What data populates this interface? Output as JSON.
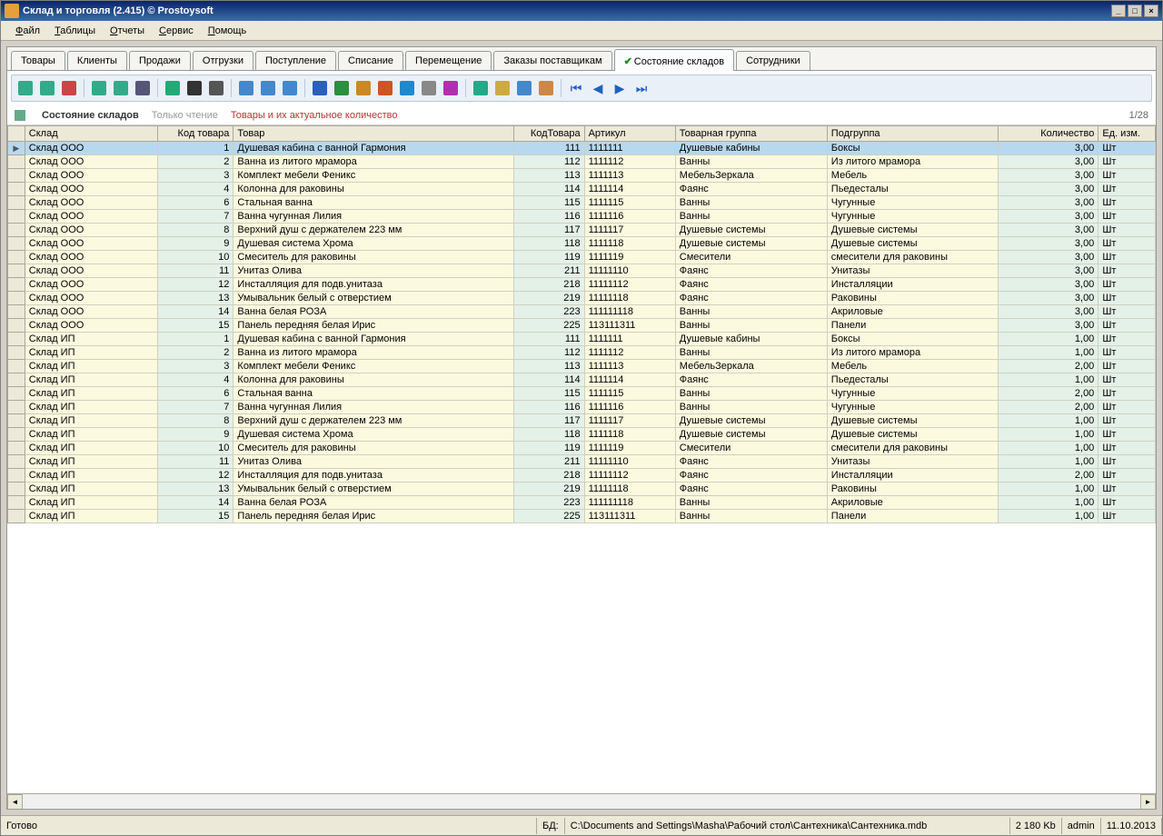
{
  "title": "Склад и торговля (2.415) © Prostoysoft",
  "menu": [
    "Файл",
    "Таблицы",
    "Отчеты",
    "Сервис",
    "Помощь"
  ],
  "tabs": [
    "Товары",
    "Клиенты",
    "Продажи",
    "Отгрузки",
    "Поступление",
    "Списание",
    "Перемещение",
    "Заказы поставщикам",
    "Состояние складов",
    "Сотрудники"
  ],
  "active_tab": 8,
  "subheader": {
    "title": "Состояние складов",
    "readonly": "Только чтение",
    "desc": "Товары и их актуальное количество",
    "page": "1/28"
  },
  "columns": [
    "Склад",
    "Код товара",
    "Товар",
    "КодТовара",
    "Артикул",
    "Товарная группа",
    "Подгруппа",
    "Количество",
    "Ед. изм."
  ],
  "rows": [
    [
      "Склад ООО",
      "1",
      "Душевая кабина с ванной Гармония",
      "111",
      "1111111",
      "Душевые кабины",
      "Боксы",
      "3,00",
      "Шт"
    ],
    [
      "Склад ООО",
      "2",
      "Ванна из литого мрамора",
      "112",
      "1111112",
      "Ванны",
      "Из литого мрамора",
      "3,00",
      "Шт"
    ],
    [
      "Склад ООО",
      "3",
      "Комплект мебели Феникс",
      "113",
      "1111113",
      "МебельЗеркала",
      "Мебель",
      "3,00",
      "Шт"
    ],
    [
      "Склад ООО",
      "4",
      "Колонна  для раковины",
      "114",
      "1111114",
      "Фаянс",
      "Пьедесталы",
      "3,00",
      "Шт"
    ],
    [
      "Склад ООО",
      "6",
      "Стальная ванна",
      "115",
      "1111115",
      "Ванны",
      "Чугунные",
      "3,00",
      "Шт"
    ],
    [
      "Склад ООО",
      "7",
      "Ванна чугунная Лилия",
      "116",
      "1111116",
      "Ванны",
      "Чугунные",
      "3,00",
      "Шт"
    ],
    [
      "Склад ООО",
      "8",
      "Верхний душ с держателем 223 мм",
      "117",
      "1111117",
      "Душевые системы",
      "Душевые системы",
      "3,00",
      "Шт"
    ],
    [
      "Склад ООО",
      "9",
      "Душевая система Хрома",
      "118",
      "1111118",
      "Душевые системы",
      "Душевые системы",
      "3,00",
      "Шт"
    ],
    [
      "Склад ООО",
      "10",
      "Смеситель для раковины",
      "119",
      "1111119",
      "Смесители",
      "смесители для раковины",
      "3,00",
      "Шт"
    ],
    [
      "Склад ООО",
      "11",
      "Унитаз Олива",
      "211",
      "11111110",
      "Фаянс",
      "Унитазы",
      "3,00",
      "Шт"
    ],
    [
      "Склад ООО",
      "12",
      "Инсталляция для подв.унитаза",
      "218",
      "11111112",
      "Фаянс",
      "Инсталляции",
      "3,00",
      "Шт"
    ],
    [
      "Склад ООО",
      "13",
      "Умывальник белый с отверстием",
      "219",
      "11111118",
      "Фаянс",
      "Раковины",
      "3,00",
      "Шт"
    ],
    [
      "Склад ООО",
      "14",
      "Ванна белая РОЗА",
      "223",
      "111111118",
      "Ванны",
      "Акриловые",
      "3,00",
      "Шт"
    ],
    [
      "Склад ООО",
      "15",
      "Панель передняя белая Ирис",
      "225",
      "113111311",
      "Ванны",
      "Панели",
      "3,00",
      "Шт"
    ],
    [
      "Склад ИП",
      "1",
      "Душевая кабина с ванной Гармония",
      "111",
      "1111111",
      "Душевые кабины",
      "Боксы",
      "1,00",
      "Шт"
    ],
    [
      "Склад ИП",
      "2",
      "Ванна из литого мрамора",
      "112",
      "1111112",
      "Ванны",
      "Из литого мрамора",
      "1,00",
      "Шт"
    ],
    [
      "Склад ИП",
      "3",
      "Комплект мебели Феникс",
      "113",
      "1111113",
      "МебельЗеркала",
      "Мебель",
      "2,00",
      "Шт"
    ],
    [
      "Склад ИП",
      "4",
      "Колонна  для раковины",
      "114",
      "1111114",
      "Фаянс",
      "Пьедесталы",
      "1,00",
      "Шт"
    ],
    [
      "Склад ИП",
      "6",
      "Стальная ванна",
      "115",
      "1111115",
      "Ванны",
      "Чугунные",
      "2,00",
      "Шт"
    ],
    [
      "Склад ИП",
      "7",
      "Ванна чугунная Лилия",
      "116",
      "1111116",
      "Ванны",
      "Чугунные",
      "2,00",
      "Шт"
    ],
    [
      "Склад ИП",
      "8",
      "Верхний душ с держателем 223 мм",
      "117",
      "1111117",
      "Душевые системы",
      "Душевые системы",
      "1,00",
      "Шт"
    ],
    [
      "Склад ИП",
      "9",
      "Душевая система Хрома",
      "118",
      "1111118",
      "Душевые системы",
      "Душевые системы",
      "1,00",
      "Шт"
    ],
    [
      "Склад ИП",
      "10",
      "Смеситель для раковины",
      "119",
      "1111119",
      "Смесители",
      "смесители для раковины",
      "1,00",
      "Шт"
    ],
    [
      "Склад ИП",
      "11",
      "Унитаз Олива",
      "211",
      "11111110",
      "Фаянс",
      "Унитазы",
      "1,00",
      "Шт"
    ],
    [
      "Склад ИП",
      "12",
      "Инсталляция для подв.унитаза",
      "218",
      "11111112",
      "Фаянс",
      "Инсталляции",
      "2,00",
      "Шт"
    ],
    [
      "Склад ИП",
      "13",
      "Умывальник белый с отверстием",
      "219",
      "11111118",
      "Фаянс",
      "Раковины",
      "1,00",
      "Шт"
    ],
    [
      "Склад ИП",
      "14",
      "Ванна белая РОЗА",
      "223",
      "111111118",
      "Ванны",
      "Акриловые",
      "1,00",
      "Шт"
    ],
    [
      "Склад ИП",
      "15",
      "Панель передняя белая Ирис",
      "225",
      "113111311",
      "Ванны",
      "Панели",
      "1,00",
      "Шт"
    ]
  ],
  "status": {
    "ready": "Готово",
    "db_label": "БД:",
    "db_path": "C:\\Documents and Settings\\Masha\\Рабочий стол\\Сантехника\\Сантехника.mdb",
    "size": "2 180 Kb",
    "user": "admin",
    "date": "11.10.2013"
  },
  "toolbar_icons": [
    {
      "n": "filter-add-icon",
      "c": "#3a8"
    },
    {
      "n": "filter-remove-icon",
      "c": "#3a8"
    },
    {
      "n": "filter-clear-icon",
      "c": "#c44"
    },
    {
      "n": "sep"
    },
    {
      "n": "funnel-icon",
      "c": "#3a8"
    },
    {
      "n": "funnel-plus-icon",
      "c": "#3a8"
    },
    {
      "n": "sql-icon",
      "c": "#557"
    },
    {
      "n": "sep"
    },
    {
      "n": "refresh-icon",
      "c": "#2a7"
    },
    {
      "n": "binoculars-icon",
      "c": "#333"
    },
    {
      "n": "print-icon",
      "c": "#555"
    },
    {
      "n": "sep"
    },
    {
      "n": "preview-icon",
      "c": "#48c"
    },
    {
      "n": "copy-icon",
      "c": "#48c"
    },
    {
      "n": "export-icon",
      "c": "#48c"
    },
    {
      "n": "sep"
    },
    {
      "n": "word-icon",
      "c": "#2a5fbd"
    },
    {
      "n": "excel-icon",
      "c": "#2a8f3e"
    },
    {
      "n": "html-icon",
      "c": "#cc8822"
    },
    {
      "n": "xml-icon",
      "c": "#cc5522"
    },
    {
      "n": "csv-icon",
      "c": "#2288cc"
    },
    {
      "n": "txt-icon",
      "c": "#888"
    },
    {
      "n": "chart-icon",
      "c": "#b030b0"
    },
    {
      "n": "sep"
    },
    {
      "n": "new-record-icon",
      "c": "#2a8"
    },
    {
      "n": "edit-record-icon",
      "c": "#ca4"
    },
    {
      "n": "grid-icon",
      "c": "#48c"
    },
    {
      "n": "layout-icon",
      "c": "#c84"
    },
    {
      "n": "sep"
    },
    {
      "n": "nav-first-icon",
      "nav": "⏮"
    },
    {
      "n": "nav-prev-icon",
      "nav": "◀"
    },
    {
      "n": "nav-next-icon",
      "nav": "▶"
    },
    {
      "n": "nav-last-icon",
      "nav": "⏭"
    }
  ]
}
